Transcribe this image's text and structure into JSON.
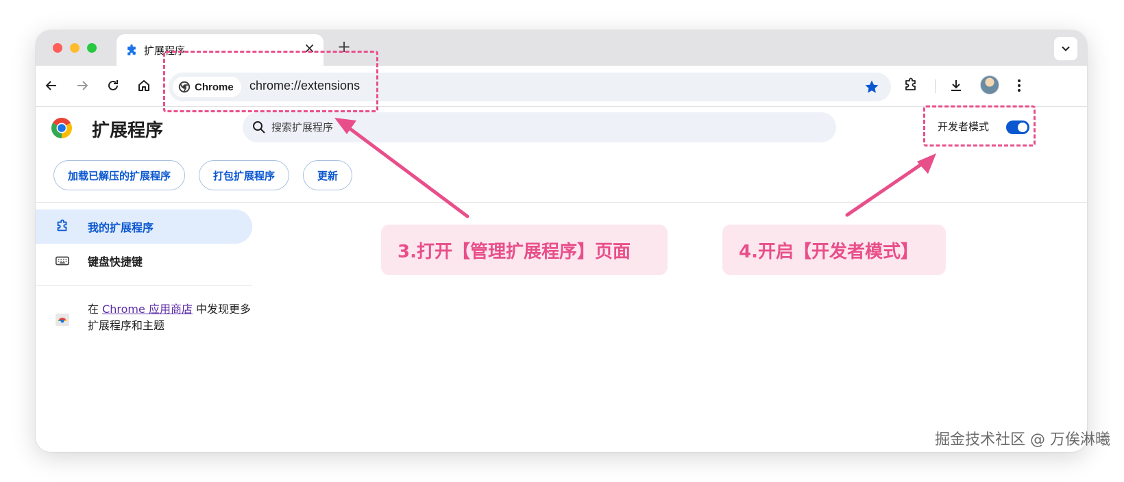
{
  "tab": {
    "title": "扩展程序",
    "close": "×",
    "new_tab": "+"
  },
  "omnibox": {
    "chip_label": "Chrome",
    "url": "chrome://extensions"
  },
  "header": {
    "title": "扩展程序",
    "search_placeholder": "搜索扩展程序",
    "dev_mode_label": "开发者模式",
    "dev_mode_on": true
  },
  "actions": {
    "load_unpacked": "加载已解压的扩展程序",
    "pack": "打包扩展程序",
    "update": "更新"
  },
  "sidebar": {
    "items": [
      {
        "label": "我的扩展程序",
        "active": true
      },
      {
        "label": "键盘快捷键",
        "active": false
      }
    ],
    "store_prefix": "在 ",
    "store_link": "Chrome 应用商店",
    "store_suffix": " 中发现更多扩展程序和主题"
  },
  "annotations": {
    "callout_3": "3.打开【管理扩展程序】页面",
    "callout_4": "4.开启【开发者模式】",
    "accent_color": "#e84f8a"
  },
  "watermark": "掘金技术社区 @ 万俟淋曦"
}
